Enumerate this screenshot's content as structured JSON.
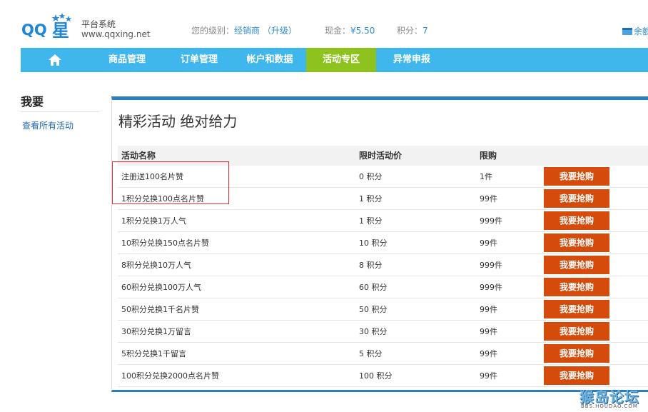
{
  "header": {
    "brand_sub": "平台系统",
    "brand_url": "www.qqxing.net",
    "level_label": "您的级别：",
    "level_value": "经销商 （升级）",
    "cash_label": "现金：",
    "cash_value": "¥5.50",
    "points_label": "积分：",
    "points_value": "7",
    "balance_label": "余额"
  },
  "logo": {
    "text_qq": "QQ",
    "text_star": "星"
  },
  "nav": {
    "items": [
      {
        "label": "商品管理"
      },
      {
        "label": "订单管理"
      },
      {
        "label": "帐户和数据"
      },
      {
        "label": "活动专区"
      },
      {
        "label": "异常申报"
      }
    ],
    "active_index": 3
  },
  "sidebar": {
    "title": "我要",
    "link": "查看所有活动"
  },
  "main": {
    "title": "精彩活动 绝对给力",
    "columns": [
      "活动名称",
      "限时活动价",
      "限购"
    ],
    "buy_label": "我要抢购",
    "rows": [
      {
        "name": "注册送100名片赞",
        "price": "0 积分",
        "limit": "1件"
      },
      {
        "name": "1积分兑换100点名片赞",
        "price": "1 积分",
        "limit": "99件"
      },
      {
        "name": "1积分兑换1万人气",
        "price": "1 积分",
        "limit": "999件"
      },
      {
        "name": "10积分兑换150点名片赞",
        "price": "10 积分",
        "limit": "99件"
      },
      {
        "name": "8积分兑换10万人气",
        "price": "8 积分",
        "limit": "999件"
      },
      {
        "name": "60积分兑换100万人气",
        "price": "60 积分",
        "limit": "999件"
      },
      {
        "name": "50积分兑换1千名片赞",
        "price": "50 积分",
        "limit": "99件"
      },
      {
        "name": "30积分兑换1万留言",
        "price": "30 积分",
        "limit": "99件"
      },
      {
        "name": "5积分兑换1千留言",
        "price": "5 积分",
        "limit": "99件"
      },
      {
        "name": "100积分兑换2000点名片赞",
        "price": "100 积分",
        "limit": "99件"
      }
    ]
  },
  "watermark": {
    "main": "猴岛论坛",
    "sub": "BBS.HOUDAO.COM"
  },
  "colors": {
    "nav": "#3fb6ec",
    "nav_active": "#8dc21f",
    "buy": "#d54b0b",
    "panel_border": "#2a7fc1",
    "link": "#2f8dd6"
  }
}
